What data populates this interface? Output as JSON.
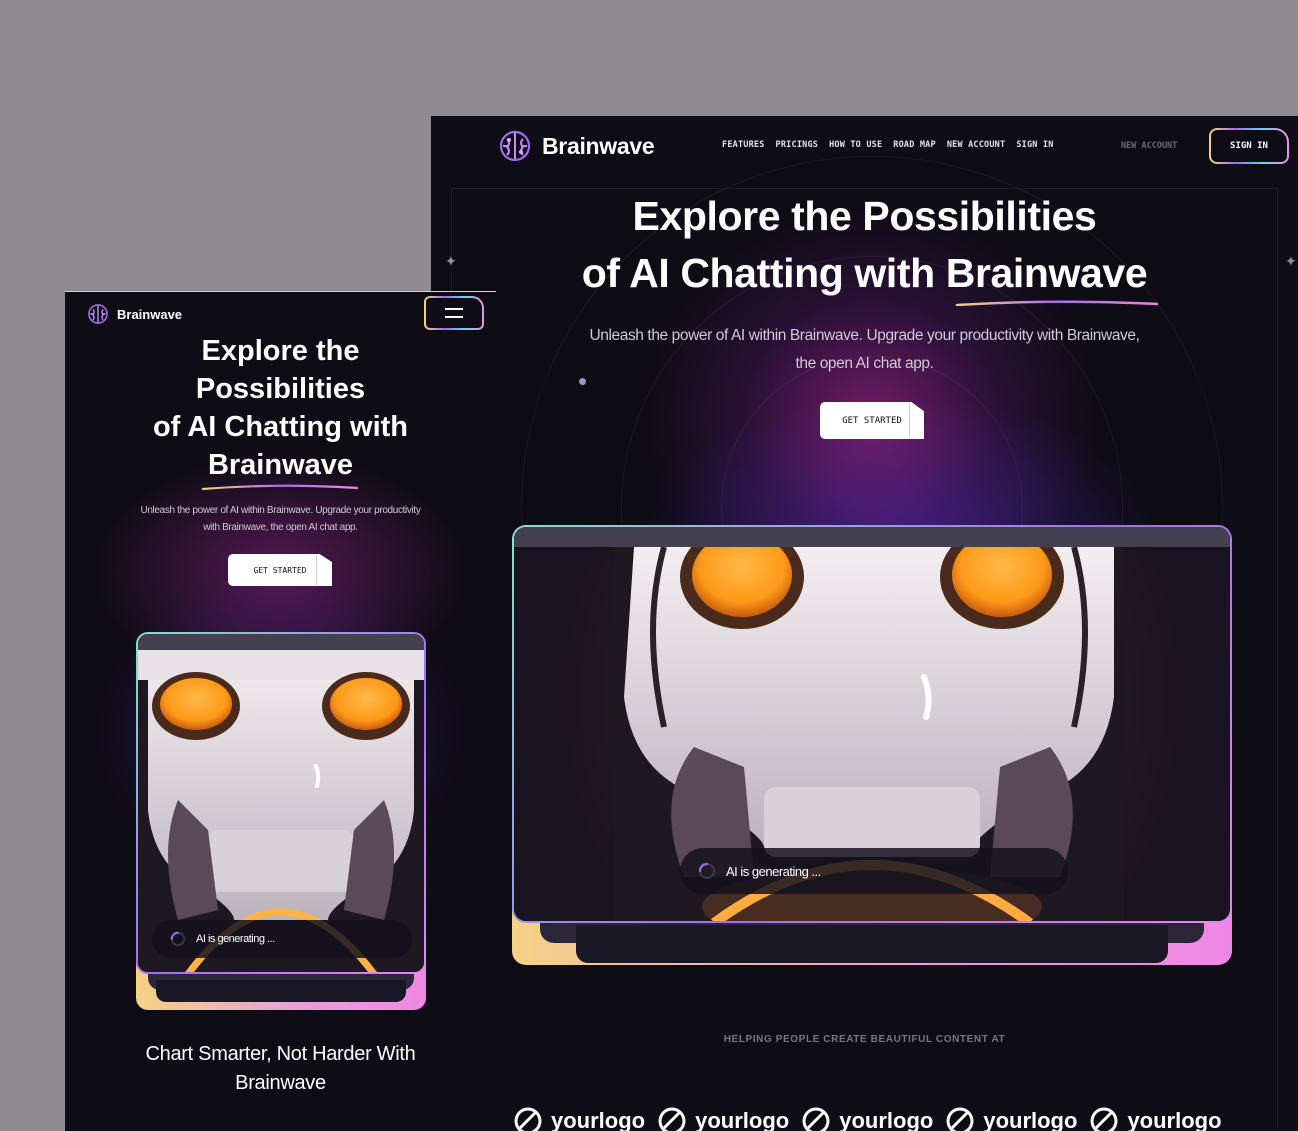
{
  "brand": {
    "name": "Brainwave"
  },
  "desktop": {
    "nav": [
      "FEATURES",
      "PRICINGS",
      "HOW TO USE",
      "ROAD MAP",
      "NEW ACCOUNT",
      "SIGN IN"
    ],
    "new_account": "NEW ACCOUNT",
    "sign_in": "SIGN IN",
    "hero": {
      "title_line1": "Explore the Possibilities",
      "title_line2": "of AI Chatting with Brainwave",
      "subtitle_line1": "Unleash the power of AI within Brainwave. Upgrade your productivity with Brainwave,",
      "subtitle_line2": "the open AI chat app.",
      "cta": "GET STARTED"
    },
    "generating": "AI is generating ...",
    "helping": "HELPING PEOPLE CREATE BEAUTIFUL CONTENT AT",
    "logos": [
      "yourlogo",
      "yourlogo",
      "yourlogo",
      "yourlogo",
      "yourlogo"
    ]
  },
  "mobile": {
    "hero": {
      "title_line1": "Explore the",
      "title_line2": "Possibilities",
      "title_line3": "of AI Chatting with",
      "title_line4": "Brainwave",
      "subtitle_line1": "Unleash the power of AI within Brainwave. Upgrade your productivity",
      "subtitle_line2": "with Brainwave, the open AI chat app.",
      "cta": "GET STARTED"
    },
    "generating": "AI is generating ...",
    "section_title_line1": "Chart Smarter, Not Harder With",
    "section_title_line2": "Brainwave"
  },
  "icons": {
    "logo": "brain-icon",
    "menu": "hamburger-menu-icon",
    "loader": "spinner-icon",
    "partner_logo": "circle-logo-icon"
  },
  "colors": {
    "background": "#0e0c15",
    "accent_yellow": "#f5d285",
    "accent_purple": "#a66cf0",
    "accent_pink": "#ef86e6",
    "accent_cyan": "#66d3e8"
  }
}
